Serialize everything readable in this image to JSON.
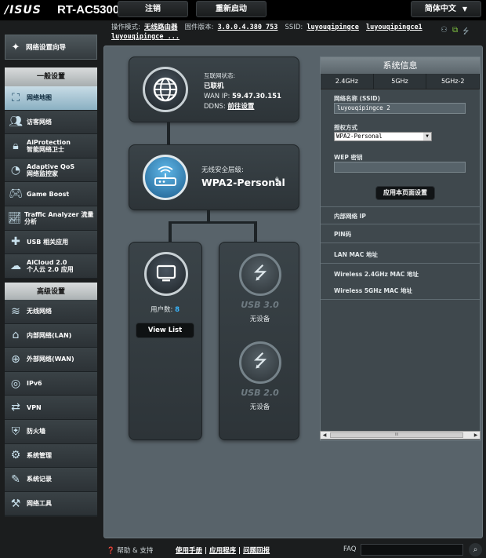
{
  "header": {
    "brand": "/ISUS",
    "model": "RT-AC5300",
    "logout_label": "注销",
    "reboot_label": "重新启动",
    "language": "简体中文"
  },
  "status": {
    "mode_label": "操作模式:",
    "mode_value": "无线路由器",
    "firmware_label": "固件版本:",
    "firmware_value": "3.0.0.4.380_753",
    "ssid_label": "SSID:",
    "ssid_values": [
      "luyouqipingce",
      "luyouqipingce1",
      "luyouqipingce ..."
    ]
  },
  "sidebar": {
    "wizard_label": "网络设置向导",
    "general_header": "一般设置",
    "general_items": [
      {
        "label": "网络地图",
        "icon": "network-map-icon"
      },
      {
        "label": "访客网络",
        "icon": "guest-network-icon"
      },
      {
        "label": "AiProtection\n智能网络卫士",
        "icon": "aiprotection-icon"
      },
      {
        "label": "Adaptive QoS\n网络监控家",
        "icon": "qos-icon"
      },
      {
        "label": "Game Boost",
        "icon": "gamepad-icon"
      },
      {
        "label": "Traffic Analyzer 流量分析",
        "icon": "traffic-analyzer-icon"
      },
      {
        "label": "USB 相关应用",
        "icon": "usb-app-icon"
      },
      {
        "label": "AiCloud 2.0\n个人云 2.0 应用",
        "icon": "cloud-icon"
      }
    ],
    "advanced_header": "高级设置",
    "advanced_items": [
      {
        "label": "无线网络",
        "icon": "wireless-icon"
      },
      {
        "label": "内部网络(LAN)",
        "icon": "lan-icon"
      },
      {
        "label": "外部网络(WAN)",
        "icon": "wan-icon"
      },
      {
        "label": "IPv6",
        "icon": "ipv6-icon"
      },
      {
        "label": "VPN",
        "icon": "vpn-icon"
      },
      {
        "label": "防火墙",
        "icon": "firewall-icon"
      },
      {
        "label": "系统管理",
        "icon": "admin-icon"
      },
      {
        "label": "系统记录",
        "icon": "log-icon"
      },
      {
        "label": "网络工具",
        "icon": "tools-icon"
      }
    ]
  },
  "map": {
    "internet_status_label": "互联网状态:",
    "internet_status_value": "已联机",
    "wan_ip_label": "WAN IP:",
    "wan_ip_value": "59.47.30.151",
    "ddns_label": "DDNS:",
    "ddns_value": "前往设置",
    "security_label": "无线安全层级:",
    "security_value": "WPA2-Personal",
    "clients_label": "用户数:",
    "clients_value": "8",
    "view_list_label": "View List",
    "usb3_label": "USB 3.0",
    "usb3_status": "无设备",
    "usb2_label": "USB 2.0",
    "usb2_status": "无设备"
  },
  "sysinfo": {
    "title": "系统信息",
    "tabs": [
      "2.4GHz",
      "5GHz",
      "5GHz-2"
    ],
    "ssid_label": "网络名称 (SSID)",
    "ssid_value": "luyouqipingce 2",
    "auth_label": "授权方式",
    "auth_value": "WPA2-Personal",
    "wep_label": "WEP 密钥",
    "wep_value": "",
    "apply_label": "应用本页面设置",
    "lan_ip_label": "内部网络 IP",
    "pin_label": "PIN码",
    "lan_mac_label": "LAN MAC 地址",
    "w24_mac_label": "Wireless 2.4GHz MAC 地址",
    "w5_mac_label": "Wireless 5GHz MAC 地址",
    "scroll_thumb": "III"
  },
  "footer": {
    "help_label": "帮助 & 支持",
    "manual": "使用手册",
    "utility": "应用程序",
    "feedback": "问题回报",
    "sep": "|",
    "faq": "FAQ"
  }
}
